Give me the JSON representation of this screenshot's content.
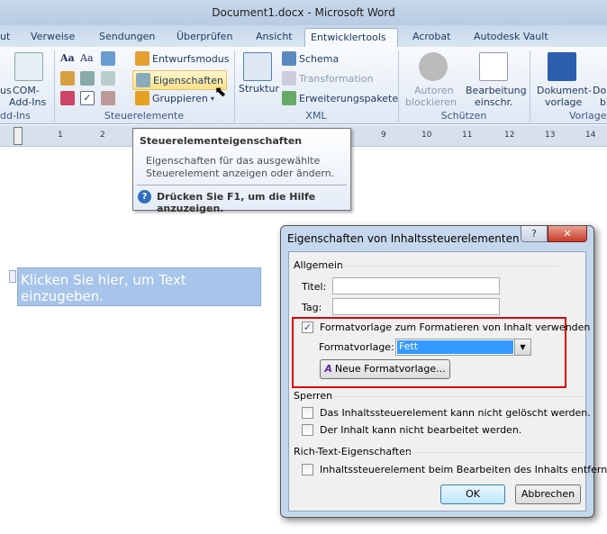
{
  "window": {
    "title": "Document1.docx  -  Microsoft Word"
  },
  "tabs": [
    {
      "label": "ut"
    },
    {
      "label": "Verweise"
    },
    {
      "label": "Sendungen"
    },
    {
      "label": "Überprüfen"
    },
    {
      "label": "Ansicht"
    },
    {
      "label": "Entwicklertools",
      "active": true
    },
    {
      "label": "Acrobat"
    },
    {
      "label": "Autodesk Vault"
    }
  ],
  "ribbon": {
    "addins": {
      "partial_label": "us",
      "com_label": "COM-\nAdd-Ins",
      "com_l1": "COM-",
      "com_l2": "Add-Ins",
      "group": "dd-Ins"
    },
    "controls": {
      "aa1": "Aa",
      "aa2": "Aa",
      "design_mode": "Entwurfsmodus",
      "properties": "Eigenschaften",
      "group_btn": "Gruppieren",
      "group": "Steuerelemente"
    },
    "xml": {
      "structure": "Struktur",
      "schema": "Schema",
      "transformation": "Transformation",
      "packages": "Erweiterungspakete",
      "group": "XML"
    },
    "protect": {
      "block1": "Autoren",
      "block2": "blockieren",
      "restrict1": "Bearbeitung",
      "restrict2": "einschr.",
      "group": "Schützen"
    },
    "templates": {
      "doc1": "Dokument-",
      "doc2": "vorlage",
      "doc_b1": "Do",
      "doc_b2": "b",
      "group": "Vorlagen"
    }
  },
  "ruler": {
    "numbers": [
      "1",
      "2",
      "9",
      "10",
      "11",
      "12",
      "13",
      "14"
    ]
  },
  "tooltip": {
    "title": "Steuerelementeigenschaften",
    "line1": "Eigenschaften für das ausgewählte",
    "line2": "Steuerelement anzeigen oder ändern.",
    "help": "Drücken Sie F1, um die Hilfe anzuzeigen."
  },
  "document": {
    "placeholder": "Klicken Sie hier, um Text einzugeben."
  },
  "dialog": {
    "title": "Eigenschaften von Inhaltssteuerelementen",
    "help_btn": "?",
    "close_btn": "✕",
    "general": "Allgemein",
    "title_label": "Titel:",
    "title_value": "",
    "tag_label": "Tag:",
    "tag_value": "",
    "use_style": {
      "label": "Formatvorlage zum Formatieren von Inhalt verwenden",
      "checked": true
    },
    "style_label": "Formatvorlage:",
    "style_value": "Fett",
    "new_style": "Neue Formatvorlage...",
    "locking": "Sperren",
    "lock_delete": {
      "label": "Das Inhaltssteuerelement kann nicht gelöscht werden.",
      "checked": false
    },
    "lock_edit": {
      "label": "Der Inhalt kann nicht bearbeitet werden.",
      "checked": false
    },
    "rich": "Rich-Text-Eigenschaften",
    "remove": {
      "label": "Inhaltssteuerelement beim Bearbeiten des Inhalts entfernen",
      "checked": false
    },
    "ok": "OK",
    "cancel": "Abbrechen",
    "highlight_color": "#e00000"
  }
}
